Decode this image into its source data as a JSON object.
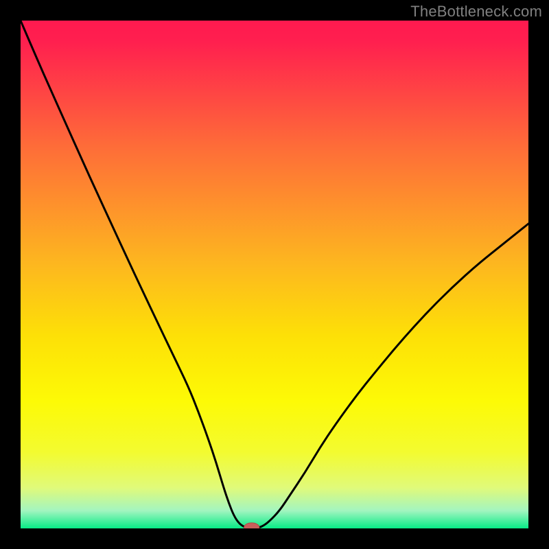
{
  "watermark": "TheBottleneck.com",
  "colors": {
    "frame": "#000000",
    "curve": "#000000",
    "marker_fill": "#c8605b",
    "marker_stroke": "#b44a45",
    "gradient_stops": [
      {
        "offset": 0.0,
        "color": "#ff1a4f"
      },
      {
        "offset": 0.04,
        "color": "#ff1f4f"
      },
      {
        "offset": 0.25,
        "color": "#fe6d38"
      },
      {
        "offset": 0.48,
        "color": "#fdb71f"
      },
      {
        "offset": 0.62,
        "color": "#fde007"
      },
      {
        "offset": 0.75,
        "color": "#fdfa06"
      },
      {
        "offset": 0.85,
        "color": "#f3fb30"
      },
      {
        "offset": 0.92,
        "color": "#e0fa7a"
      },
      {
        "offset": 0.965,
        "color": "#a3f5c0"
      },
      {
        "offset": 1.0,
        "color": "#07eb86"
      }
    ]
  },
  "chart_data": {
    "type": "line",
    "title": "",
    "xlabel": "",
    "ylabel": "",
    "xlim": [
      0,
      100
    ],
    "ylim": [
      0,
      100
    ],
    "grid": false,
    "legend": false,
    "series": [
      {
        "name": "bottleneck-curve",
        "x": [
          0.0,
          3.0,
          6.0,
          9.0,
          12.0,
          15.0,
          18.0,
          21.0,
          24.0,
          27.0,
          30.0,
          33.0,
          35.0,
          37.0,
          38.5,
          40.0,
          41.0,
          42.0,
          43.0,
          44.0,
          45.0,
          46.0,
          47.5,
          49.0,
          51.0,
          53.0,
          56.0,
          59.0,
          62.0,
          66.0,
          70.0,
          75.0,
          80.0,
          85.0,
          90.0,
          95.0,
          100.0
        ],
        "values": [
          100.0,
          93.0,
          86.2,
          79.5,
          72.8,
          66.2,
          59.7,
          53.2,
          46.8,
          40.5,
          34.2,
          28.0,
          23.0,
          17.5,
          13.0,
          8.0,
          5.0,
          2.5,
          1.0,
          0.3,
          0.0,
          0.0,
          0.3,
          1.4,
          3.5,
          6.5,
          11.0,
          16.0,
          20.5,
          26.0,
          31.0,
          37.0,
          42.5,
          47.5,
          52.0,
          56.0,
          60.0
        ]
      }
    ],
    "marker": {
      "x": 45.5,
      "y": 0.2,
      "rx": 1.5,
      "ry": 0.9
    }
  }
}
